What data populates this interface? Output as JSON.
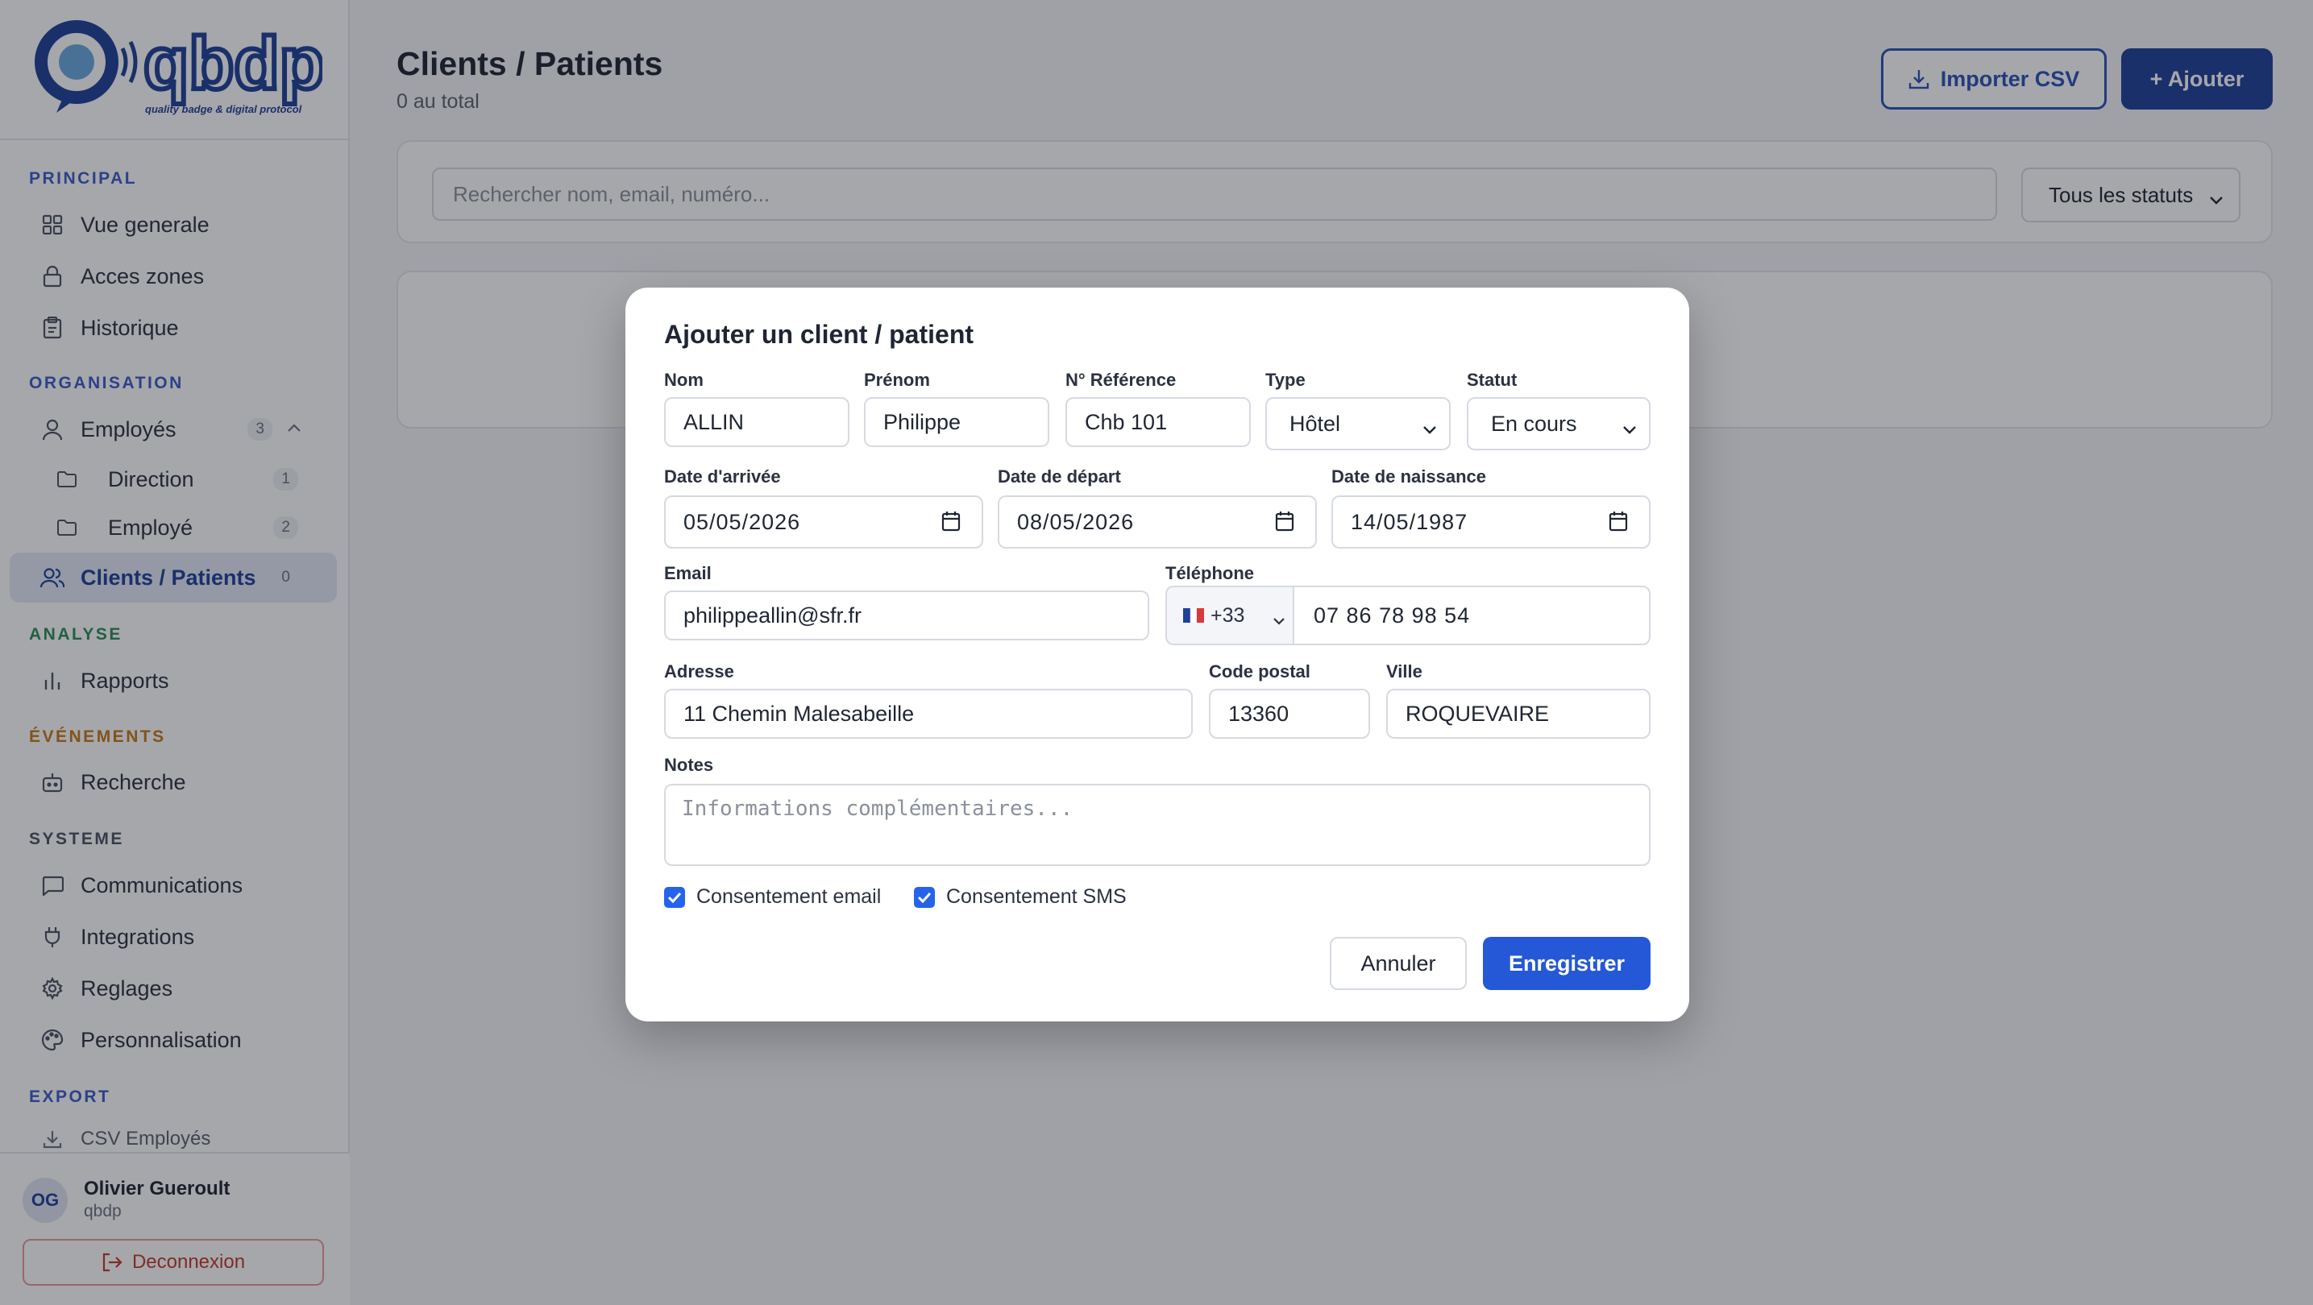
{
  "brand": {
    "logo_text": "qbdp",
    "tagline": "quality badge & digital protocol"
  },
  "sidebar": {
    "sections": {
      "principal": "PRINCIPAL",
      "organisation": "ORGANISATION",
      "analyse": "ANALYSE",
      "evenements": "ÉVÉNEMENTS",
      "systeme": "SYSTEME",
      "export": "EXPORT"
    },
    "items": {
      "vue": "Vue generale",
      "acces": "Acces zones",
      "historique": "Historique",
      "employes": "Employés",
      "employes_count": "3",
      "direction": "Direction",
      "direction_count": "1",
      "employe": "Employé",
      "employe_count": "2",
      "clients": "Clients / Patients",
      "clients_count": "0",
      "rapports": "Rapports",
      "recherche": "Recherche",
      "communications": "Communications",
      "integrations": "Integrations",
      "reglages": "Reglages",
      "personnalisation": "Personnalisation",
      "csv_employes": "CSV Employés"
    },
    "user": {
      "initials": "OG",
      "name": "Olivier Gueroult",
      "org": "qbdp",
      "logout": "Deconnexion"
    }
  },
  "header": {
    "title": "Clients / Patients",
    "subtitle": "0 au total",
    "import_label": "Importer CSV",
    "add_label": "+ Ajouter"
  },
  "filters": {
    "search_placeholder": "Rechercher nom, email, numéro...",
    "status_value": "Tous les statuts"
  },
  "modal": {
    "title": "Ajouter un client / patient",
    "labels": {
      "nom": "Nom",
      "prenom": "Prénom",
      "reference": "N° Référence",
      "type": "Type",
      "statut": "Statut",
      "arrivee": "Date d'arrivée",
      "depart": "Date de départ",
      "naissance": "Date de naissance",
      "email": "Email",
      "telephone": "Téléphone",
      "adresse": "Adresse",
      "code_postal": "Code postal",
      "ville": "Ville",
      "notes": "Notes"
    },
    "values": {
      "nom": "ALLIN",
      "prenom": "Philippe",
      "reference": "Chb 101",
      "type": "Hôtel",
      "statut": "En cours",
      "arrivee": "05/05/2026",
      "depart": "08/05/2026",
      "naissance": "14/05/1987",
      "email": "philippeallin@sfr.fr",
      "phone_code": "+33",
      "telephone": "07 86 78 98 54",
      "adresse": "11 Chemin Malesabeille",
      "code_postal": "13360",
      "ville": "ROQUEVAIRE"
    },
    "notes_placeholder": "Informations complémentaires...",
    "consent_email": "Consentement email",
    "consent_sms": "Consentement SMS",
    "consent_email_checked": true,
    "consent_sms_checked": true,
    "cancel": "Annuler",
    "save": "Enregistrer"
  },
  "colors": {
    "primary": "#1e3f9a",
    "accent": "#2458d6",
    "danger": "#c0392b",
    "section_blue": "#3b5bcc",
    "section_green": "#2e8b57",
    "section_orange": "#c27a1a",
    "section_gray": "#4b5263"
  }
}
